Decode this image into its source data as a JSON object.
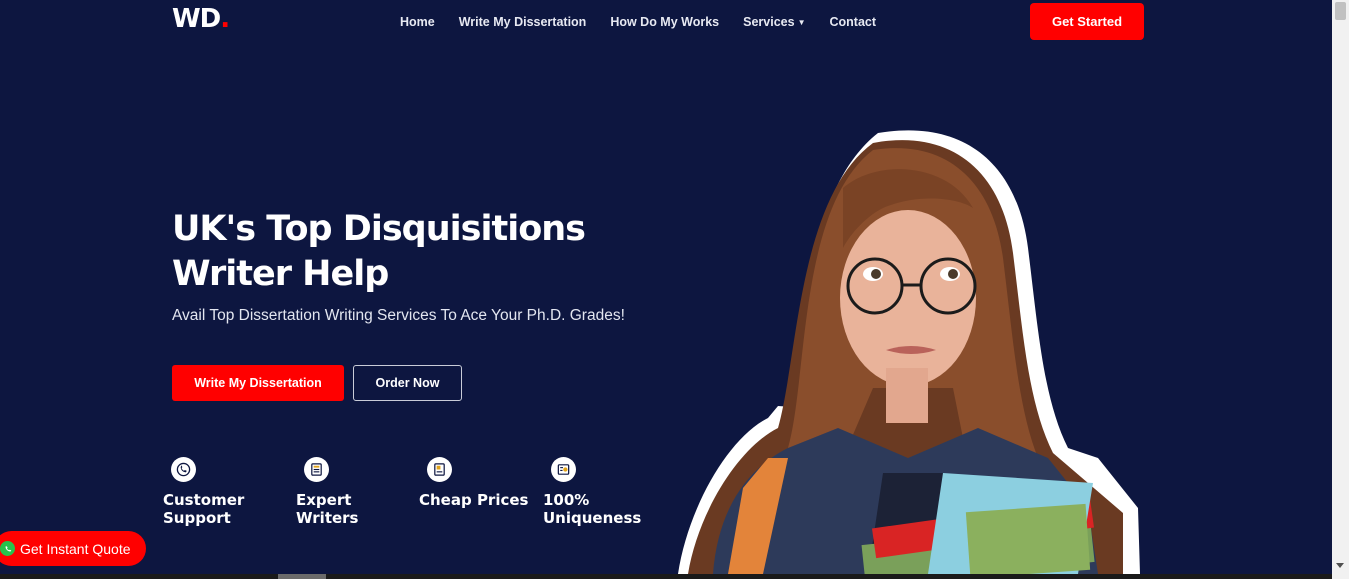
{
  "logo": {
    "text": "WD",
    "accent": "."
  },
  "nav": {
    "items": [
      {
        "label": "Home"
      },
      {
        "label": "Write My Dissertation"
      },
      {
        "label": "How Do My Works"
      },
      {
        "label": "Services",
        "caret": "▼"
      },
      {
        "label": "Contact"
      }
    ],
    "cta_label": "Get Started"
  },
  "hero": {
    "title": "UK's Top Disquisitions Writer Help",
    "subtitle": "Avail Top Dissertation Writing Services To Ace Your Ph.D. Grades!",
    "primary_button": "Write My Dissertation",
    "secondary_button": "Order Now"
  },
  "features": [
    {
      "icon": "headset-icon",
      "label": "Customer\nSupport"
    },
    {
      "icon": "writer-icon",
      "label": "Expert\nWriters"
    },
    {
      "icon": "price-tag-icon",
      "label": "Cheap Prices"
    },
    {
      "icon": "certificate-icon",
      "label": "100%\nUniqueness"
    }
  ],
  "floating": {
    "quote_label": "Get Instant Quote",
    "icon": "whatsapp-icon"
  },
  "colors": {
    "background": "#0d1640",
    "accent": "#ff0000",
    "text": "#ffffff"
  }
}
